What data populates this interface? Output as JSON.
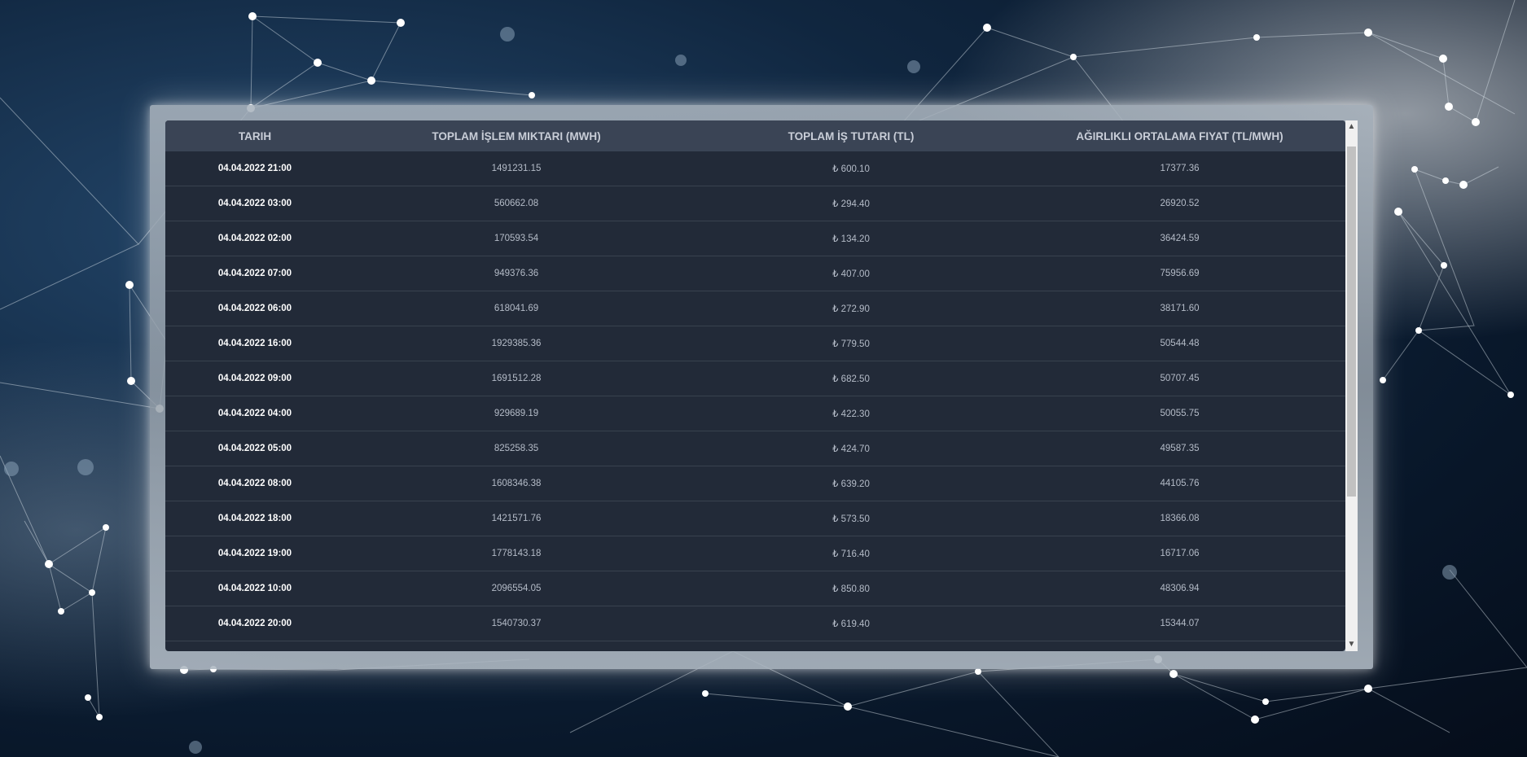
{
  "table": {
    "headers": {
      "date": "TARIH",
      "volume": "TOPLAM İŞLEM MIKTARI (MWH)",
      "amount": "TOPLAM İŞ TUTARI (TL)",
      "price": "AĞIRLIKLI ORTALAMA FIYAT (TL/MWH)"
    },
    "rows": [
      {
        "date": "04.04.2022 21:00",
        "volume": "1491231.15",
        "amount": "₺ 600.10",
        "price": "17377.36"
      },
      {
        "date": "04.04.2022 03:00",
        "volume": "560662.08",
        "amount": "₺ 294.40",
        "price": "26920.52"
      },
      {
        "date": "04.04.2022 02:00",
        "volume": "170593.54",
        "amount": "₺ 134.20",
        "price": "36424.59"
      },
      {
        "date": "04.04.2022 07:00",
        "volume": "949376.36",
        "amount": "₺ 407.00",
        "price": "75956.69"
      },
      {
        "date": "04.04.2022 06:00",
        "volume": "618041.69",
        "amount": "₺ 272.90",
        "price": "38171.60"
      },
      {
        "date": "04.04.2022 16:00",
        "volume": "1929385.36",
        "amount": "₺ 779.50",
        "price": "50544.48"
      },
      {
        "date": "04.04.2022 09:00",
        "volume": "1691512.28",
        "amount": "₺ 682.50",
        "price": "50707.45"
      },
      {
        "date": "04.04.2022 04:00",
        "volume": "929689.19",
        "amount": "₺ 422.30",
        "price": "50055.75"
      },
      {
        "date": "04.04.2022 05:00",
        "volume": "825258.35",
        "amount": "₺ 424.70",
        "price": "49587.35"
      },
      {
        "date": "04.04.2022 08:00",
        "volume": "1608346.38",
        "amount": "₺ 639.20",
        "price": "44105.76"
      },
      {
        "date": "04.04.2022 18:00",
        "volume": "1421571.76",
        "amount": "₺ 573.50",
        "price": "18366.08"
      },
      {
        "date": "04.04.2022 19:00",
        "volume": "1778143.18",
        "amount": "₺ 716.40",
        "price": "16717.06"
      },
      {
        "date": "04.04.2022 10:00",
        "volume": "2096554.05",
        "amount": "₺ 850.80",
        "price": "48306.94"
      },
      {
        "date": "04.04.2022 20:00",
        "volume": "1540730.37",
        "amount": "₺ 619.40",
        "price": "15344.07"
      }
    ]
  },
  "scrollbar": {
    "up_icon": "chevron-up-icon",
    "down_icon": "chevron-down-icon"
  },
  "colors": {
    "panel": "#222a38",
    "header": "#3a4455",
    "row_border": "#39424f",
    "date_text": "#ffffff",
    "value_text": "#b5bcc8"
  }
}
